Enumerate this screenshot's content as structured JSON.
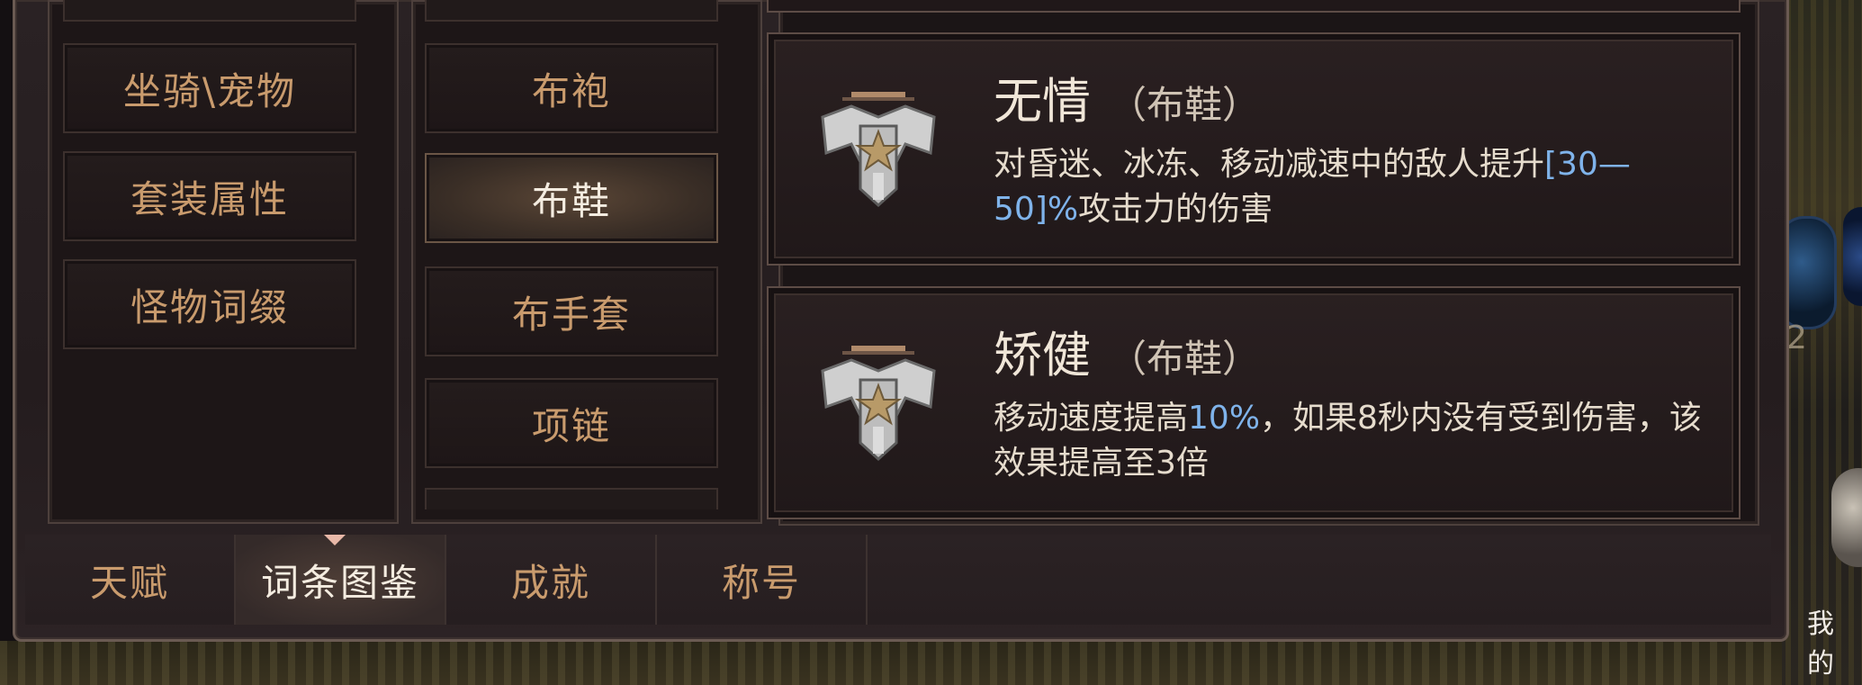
{
  "categories": [
    {
      "label": ""
    },
    {
      "label": "坐骑\\宠物"
    },
    {
      "label": "套装属性"
    },
    {
      "label": "怪物词缀"
    }
  ],
  "subcategories": [
    {
      "label": ""
    },
    {
      "label": "布袍"
    },
    {
      "label": "布鞋",
      "active": true
    },
    {
      "label": "布手套"
    },
    {
      "label": "项链"
    }
  ],
  "affixes": [
    {
      "name": "无情",
      "type": "（布鞋）",
      "desc_before": "对昏迷、冰冻、移动减速中的敌人提升",
      "desc_highlight": "[30—50]%",
      "desc_after": "攻击力的伤害",
      "icon": "eagle-emblem-icon"
    },
    {
      "name": "矫健",
      "type": "（布鞋）",
      "desc_before": "移动速度提高",
      "desc_highlight": "10%",
      "desc_after": "，如果8秒内没有受到伤害，该效果提高至3倍",
      "icon": "eagle-emblem-icon"
    }
  ],
  "tabs": [
    {
      "label": "天赋"
    },
    {
      "label": "词条图鉴",
      "active": true
    },
    {
      "label": "成就"
    },
    {
      "label": "称号"
    }
  ],
  "world": {
    "hud_label": "我的",
    "hud_number": "2"
  },
  "colors": {
    "highlight": "#7fb3ea",
    "menu_text": "#c99b6d",
    "active_text": "#f4ece0"
  }
}
